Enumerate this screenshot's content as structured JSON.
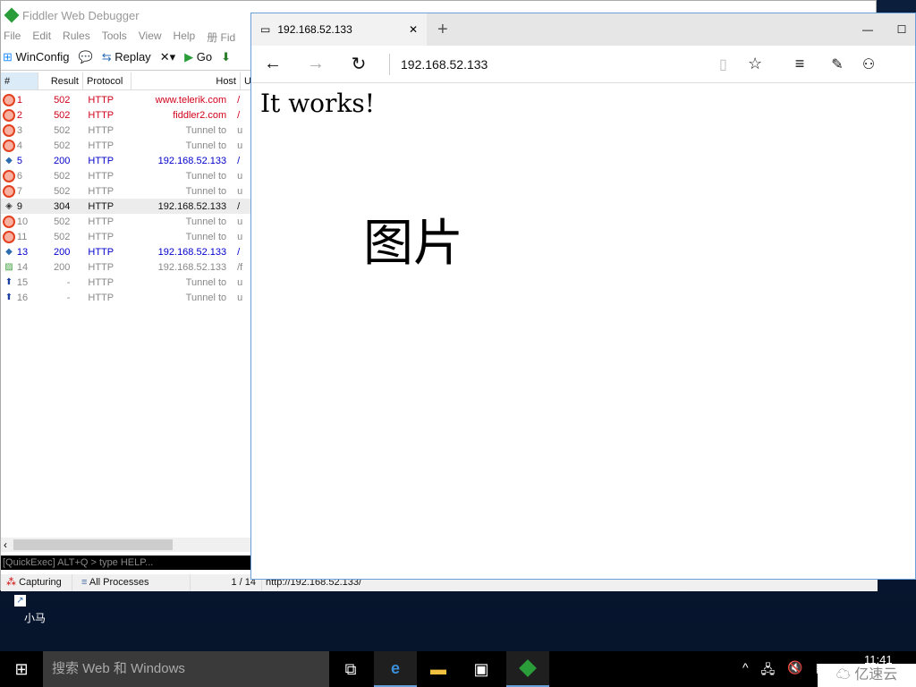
{
  "fiddler": {
    "title": "Fiddler Web Debugger",
    "menu": [
      "File",
      "Edit",
      "Rules",
      "Tools",
      "View",
      "Help",
      "册 Fid"
    ],
    "toolbar": {
      "winconfig": "WinConfig",
      "replay": "Replay",
      "go": "Go"
    },
    "columns": [
      "#",
      "Result",
      "Protocol",
      "Host",
      "U"
    ],
    "sessions": [
      {
        "num": "1",
        "result": "502",
        "protocol": "HTTP",
        "host": "www.telerik.com",
        "url": "/",
        "color": "#d0021b",
        "icon": "error"
      },
      {
        "num": "2",
        "result": "502",
        "protocol": "HTTP",
        "host": "fiddler2.com",
        "url": "/",
        "color": "#d0021b",
        "icon": "error"
      },
      {
        "num": "3",
        "result": "502",
        "protocol": "HTTP",
        "host": "Tunnel to",
        "url": "u",
        "color": "#888888",
        "icon": "error"
      },
      {
        "num": "4",
        "result": "502",
        "protocol": "HTTP",
        "host": "Tunnel to",
        "url": "u",
        "color": "#888888",
        "icon": "error"
      },
      {
        "num": "5",
        "result": "200",
        "protocol": "HTTP",
        "host": "192.168.52.133",
        "url": "/",
        "color": "#0000cc",
        "icon": "html"
      },
      {
        "num": "6",
        "result": "502",
        "protocol": "HTTP",
        "host": "Tunnel to",
        "url": "u",
        "color": "#888888",
        "icon": "error"
      },
      {
        "num": "7",
        "result": "502",
        "protocol": "HTTP",
        "host": "Tunnel to",
        "url": "u",
        "color": "#888888",
        "icon": "error"
      },
      {
        "num": "9",
        "result": "304",
        "protocol": "HTTP",
        "host": "192.168.52.133",
        "url": "/",
        "color": "#111111",
        "icon": "cached",
        "selected": true
      },
      {
        "num": "10",
        "result": "502",
        "protocol": "HTTP",
        "host": "Tunnel to",
        "url": "u",
        "color": "#888888",
        "icon": "error"
      },
      {
        "num": "11",
        "result": "502",
        "protocol": "HTTP",
        "host": "Tunnel to",
        "url": "u",
        "color": "#888888",
        "icon": "error"
      },
      {
        "num": "13",
        "result": "200",
        "protocol": "HTTP",
        "host": "192.168.52.133",
        "url": "/",
        "color": "#0000cc",
        "icon": "html"
      },
      {
        "num": "14",
        "result": "200",
        "protocol": "HTTP",
        "host": "192.168.52.133",
        "url": "/f",
        "color": "#888888",
        "icon": "image"
      },
      {
        "num": "15",
        "result": "-",
        "protocol": "HTTP",
        "host": "Tunnel to",
        "url": "u",
        "color": "#888888",
        "icon": "upload"
      },
      {
        "num": "16",
        "result": "-",
        "protocol": "HTTP",
        "host": "Tunnel to",
        "url": "u",
        "color": "#888888",
        "icon": "upload"
      }
    ],
    "quickexec": "[QuickExec] ALT+Q > type HELP...",
    "status": {
      "capturing": "Capturing",
      "processes": "All Processes",
      "count": "1 / 14",
      "url": "http://192.168.52.133/"
    }
  },
  "browser": {
    "tab_title": "192.168.52.133",
    "address": "192.168.52.133",
    "content_heading": "It works!",
    "content_image_text": "图片"
  },
  "desktop": {
    "icon_label": "小马"
  },
  "taskbar": {
    "search_placeholder": "搜索 Web 和 Windows",
    "clock": "11:41",
    "watermark": "亿速云"
  }
}
